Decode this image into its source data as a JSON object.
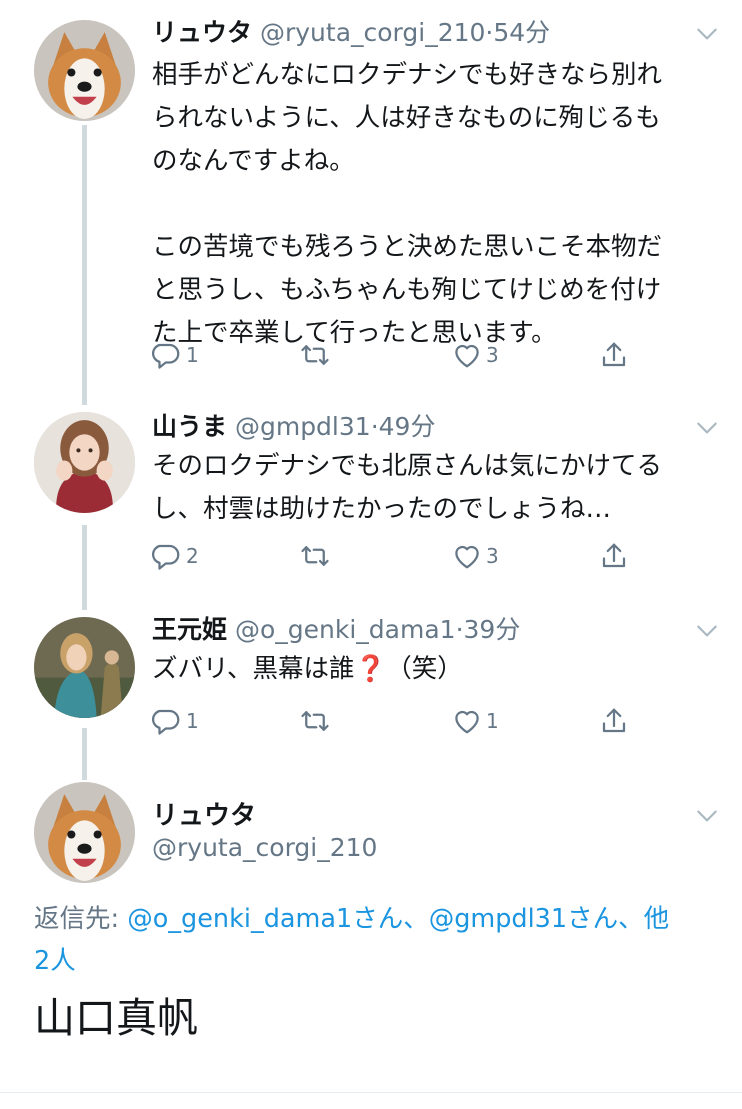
{
  "tweets": [
    {
      "name": "リュウタ",
      "handle": "@ryuta_corgi_210",
      "dot": "·",
      "time": "54分",
      "text_paragraphs": [
        "相手がどんなにロクデナシでも好きなら別れ\nられないように、人は好きなものに殉じるも\nのなんですよね。",
        "この苦境でも残ろうと決めた思いこそ本物だ\nと思うし、もふちゃんも殉じてけじめを付け\nた上で卒業して行ったと思います。"
      ],
      "reply_count": "1",
      "retweet_count": "",
      "like_count": "3",
      "avatar": "corgi-avatar"
    },
    {
      "name": "山うま",
      "handle": "@gmpdl31",
      "dot": "·",
      "time": "49分",
      "text_paragraphs": [
        "そのロクデナシでも北原さんは気にかけてる\nし、村雲は助けたかったのでしょうね…"
      ],
      "reply_count": "2",
      "retweet_count": "",
      "like_count": "3",
      "avatar": "woman-avatar"
    },
    {
      "name": "王元姫",
      "handle": "@o_genki_dama1",
      "dot": "·",
      "time": "39分",
      "text_paragraphs": [
        "ズバリ、黒幕は誰❓（笑）"
      ],
      "reply_count": "1",
      "retweet_count": "",
      "like_count": "1",
      "avatar": "game-character-avatar"
    }
  ],
  "focus_tweet": {
    "name": "リュウタ",
    "handle": "@ryuta_corgi_210",
    "reply_label": "返信先: ",
    "reply_users": "@o_genki_dama1さん、@gmpdl31さん、他\n2人",
    "text": "山口真帆"
  },
  "colors": {
    "text": "#14171a",
    "secondary": "#657786",
    "link": "#1b95e0",
    "thread_line": "#cfd9de"
  },
  "icons": [
    "reply-icon",
    "retweet-icon",
    "like-icon",
    "share-icon",
    "chevron-down-icon"
  ]
}
